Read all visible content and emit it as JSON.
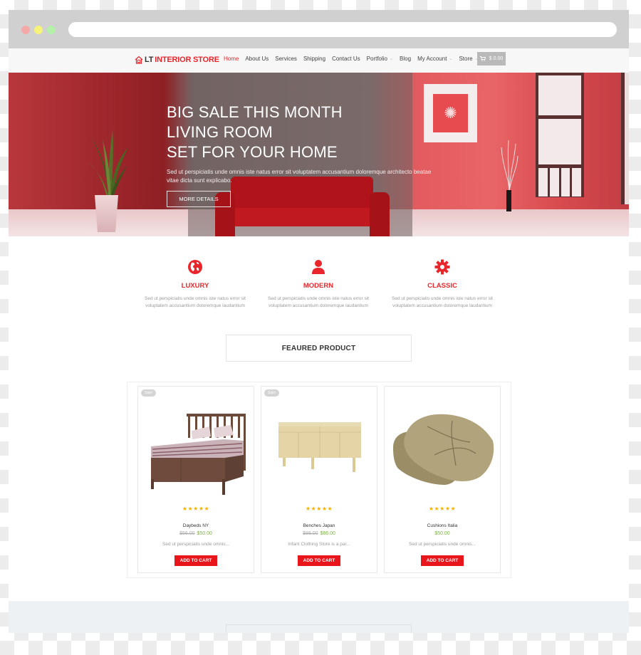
{
  "browser": {
    "window_buttons": [
      "close",
      "minimize",
      "maximize"
    ],
    "address_bar_value": ""
  },
  "header": {
    "logo": {
      "icon": "house-icon",
      "prefix": "LT",
      "name": "INTERIOR STORE"
    },
    "menu": [
      {
        "label": "Home",
        "active": true,
        "has_dropdown": false
      },
      {
        "label": "About Us",
        "active": false,
        "has_dropdown": false
      },
      {
        "label": "Services",
        "active": false,
        "has_dropdown": false
      },
      {
        "label": "Shipping",
        "active": false,
        "has_dropdown": false
      },
      {
        "label": "Contact Us",
        "active": false,
        "has_dropdown": false
      },
      {
        "label": "Portfolio",
        "active": false,
        "has_dropdown": true
      },
      {
        "label": "Blog",
        "active": false,
        "has_dropdown": false
      },
      {
        "label": "My Account",
        "active": false,
        "has_dropdown": true
      },
      {
        "label": "Store",
        "active": false,
        "has_dropdown": true
      }
    ],
    "cart": {
      "icon": "cart-icon",
      "total": "$ 0.00"
    }
  },
  "hero": {
    "title_lines": [
      "BIG SALE THIS MONTH",
      "LIVING ROOM",
      "SET FOR YOUR HOME"
    ],
    "description": "Sed ut perspiciatis unde omnis iste natus error sit voluptatem accusantium doloremque architecto beatae vitae dicta sunt explicabo.",
    "button_label": "MORE DETAILS"
  },
  "features": [
    {
      "icon": "globe-icon",
      "title": "LUXURY",
      "description": "Sed ut perspiciatis unde omnis iste natus error sit voluptatem accusantium doloremque laudantium"
    },
    {
      "icon": "user-icon",
      "title": "MODERN",
      "description": "Sed ut perspiciatis unde omnis iste natus error sit voluptatem accusantium doloremque laudantium"
    },
    {
      "icon": "gear-icon",
      "title": "CLASSIC",
      "description": "Sed ut perspiciatis unde omnis iste natus error sit voluptatem accusantium doloremque laudantium"
    }
  ],
  "featured": {
    "title": "FEAURED PRODUCT",
    "products": [
      {
        "badge": "Sale!",
        "image": "bed",
        "rating": 5,
        "stars": "★★★★★",
        "name": "Daybeds NY",
        "old_price": "$56.00",
        "price": "$50.00",
        "description": "Sed ut perspiciatis unde omnis...",
        "button": "ADD TO CART"
      },
      {
        "badge": "Sale!",
        "image": "sideboard",
        "rating": 5,
        "stars": "★★★★★",
        "name": "Benches Japan",
        "old_price": "$89.00",
        "price": "$86.00",
        "description": "Infant Clothing Store is a par...",
        "button": "ADD TO CART"
      },
      {
        "badge": "",
        "image": "cushion",
        "rating": 5,
        "stars": "★★★★★",
        "name": "Cushions Italia",
        "old_price": "",
        "price": "$50.00",
        "description": "Sed ut perspiciatis unde omnis...",
        "button": "ADD TO CART"
      }
    ]
  },
  "colors": {
    "accent": "#e8262b",
    "sale_price": "#7cb342",
    "stars": "#f6b100",
    "badge": "#d4d4d4"
  }
}
